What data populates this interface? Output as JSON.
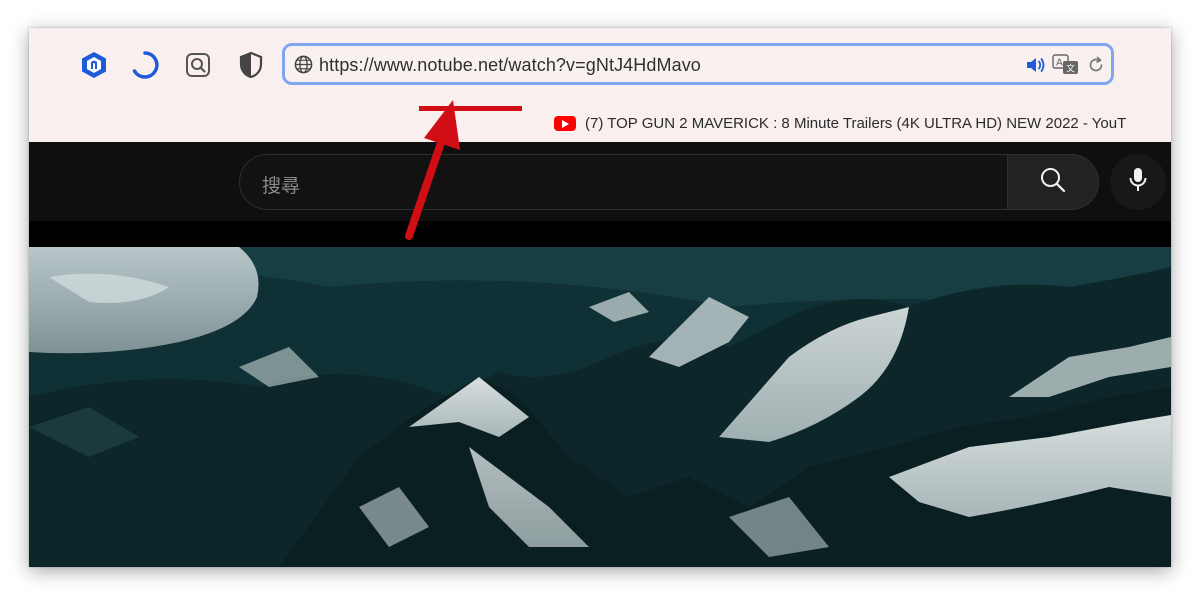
{
  "browser": {
    "url": "https://www.notube.net/watch?v=gNtJ4HdMavo",
    "tab_title": "(7) TOP GUN 2 MAVERICK : 8 Minute Trailers (4K ULTRA HD) NEW 2022 - YouT",
    "toolbar_icons": [
      "extension-hexagon-icon",
      "loading-spinner-icon",
      "search-extension-icon",
      "privacy-shield-icon"
    ],
    "url_bar_icons": [
      "globe-icon",
      "speaker-icon",
      "translate-icon",
      "reload-icon"
    ]
  },
  "youtube": {
    "search_placeholder": "搜尋",
    "icons": [
      "search-icon",
      "microphone-icon"
    ]
  },
  "annotation": {
    "highlight": "notube.net",
    "color": "#d10d16"
  }
}
